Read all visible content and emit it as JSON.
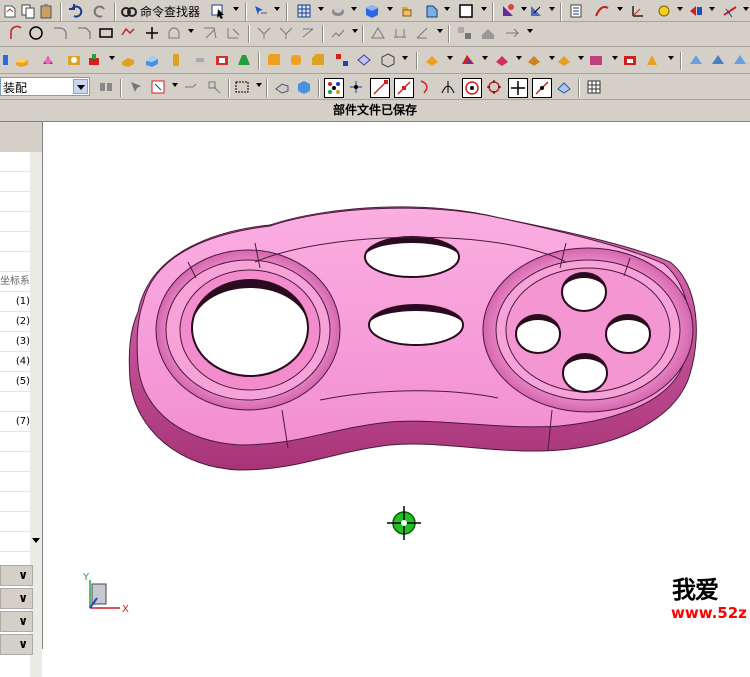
{
  "toolbar": {
    "command_finder_label": "命令查找器",
    "assembly_select_value": "装配"
  },
  "status": {
    "message": "部件文件已保存"
  },
  "navigator": {
    "section_label": "坐标系",
    "rows": [
      "(1)",
      "(2)",
      "(3)",
      "(4)",
      "(5)",
      "(7)"
    ]
  },
  "triad": {
    "x_label": "X",
    "y_label": "Y"
  },
  "watermark": {
    "text": "我爱",
    "url": "www.52z"
  },
  "colors": {
    "part_face": "#f79fd8",
    "part_side": "#c0458e",
    "hole_interior": "#2a0a1f",
    "toolbar_bg": "#d4d0c8",
    "crosshair": "#22c022"
  },
  "icons": [
    "undo-icon",
    "redo-icon",
    "command-finder-icon",
    "arc-icon",
    "circle-icon",
    "rectangle-icon",
    "line-icon",
    "point-icon",
    "sketch-icon",
    "extrude-icon",
    "snap-icon",
    "grid-icon"
  ]
}
